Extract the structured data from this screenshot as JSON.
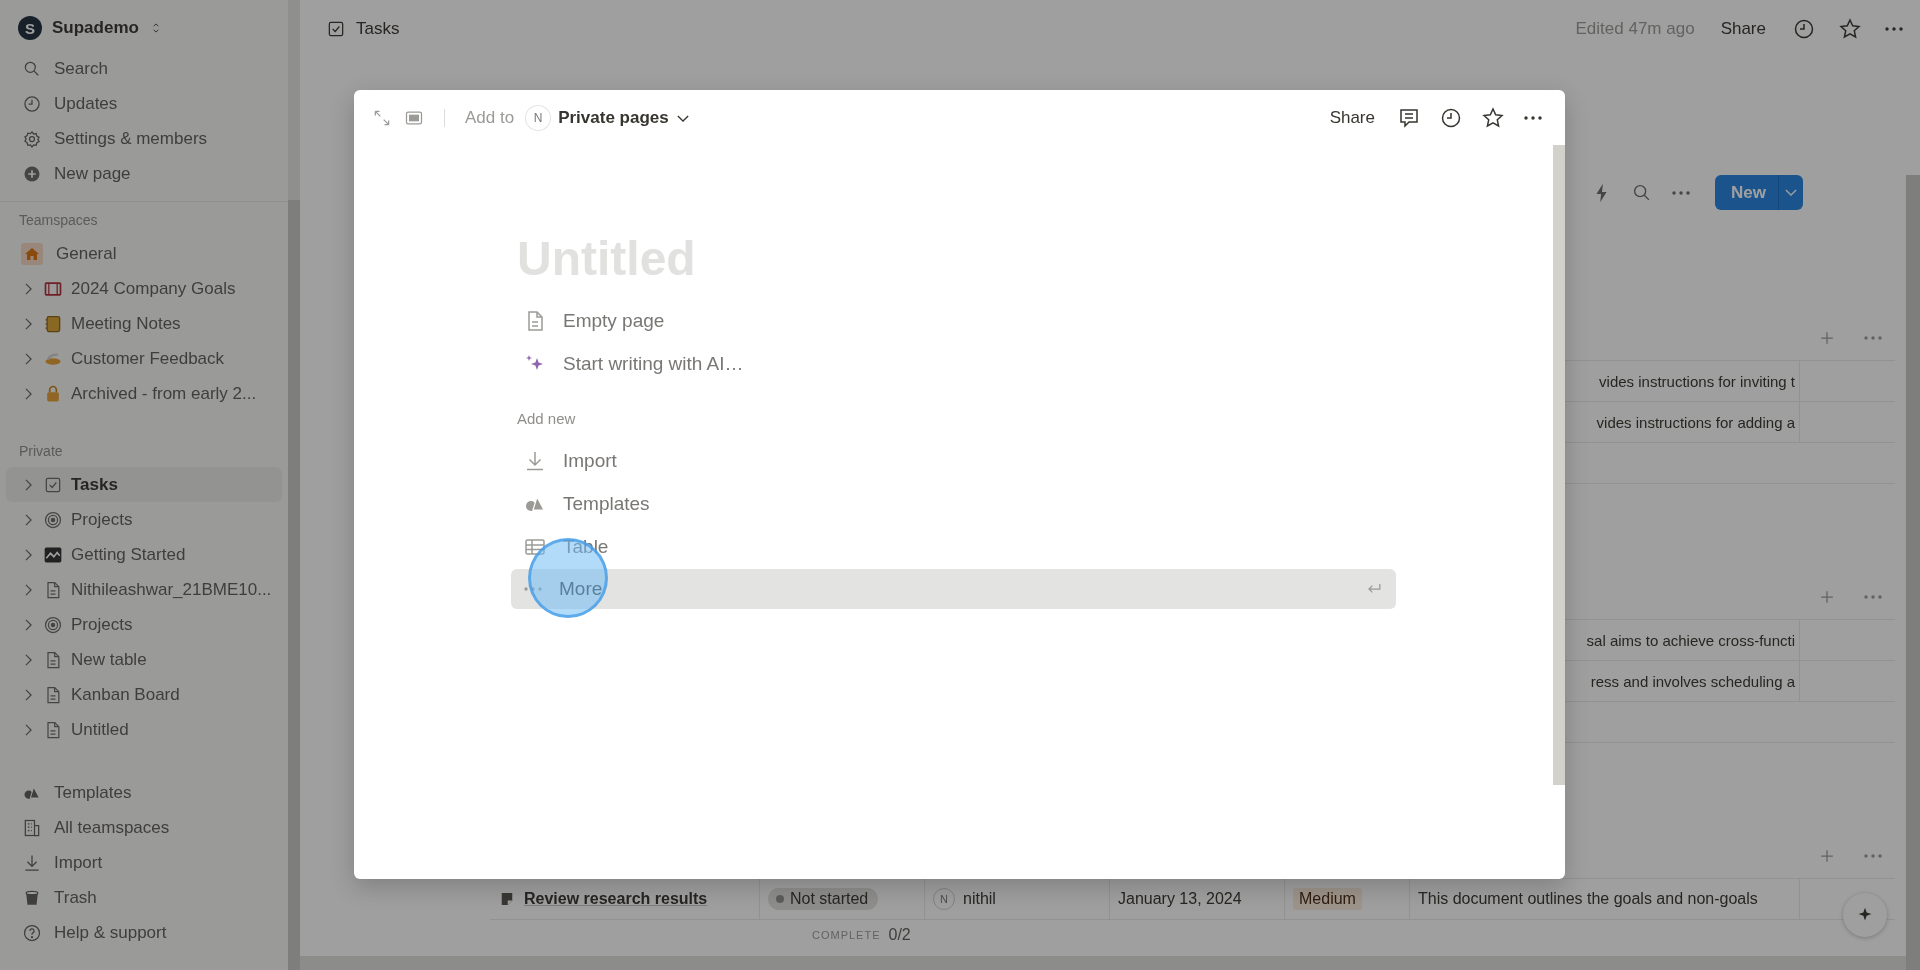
{
  "sidebar": {
    "workspace": {
      "avatar": "S",
      "name": "Supademo"
    },
    "actions": [
      {
        "kind": "search",
        "label": "Search"
      },
      {
        "kind": "clock",
        "label": "Updates"
      },
      {
        "kind": "gear",
        "label": "Settings & members"
      },
      {
        "kind": "plus",
        "label": "New page"
      }
    ],
    "sections": [
      {
        "title": "Teamspaces",
        "items": [
          {
            "kind": "home",
            "label": "General",
            "expandable": false,
            "selected": false
          },
          {
            "kind": "goals",
            "label": "2024 Company Goals",
            "expandable": true,
            "selected": false
          },
          {
            "kind": "notebook",
            "label": "Meeting Notes",
            "expandable": true,
            "selected": false
          },
          {
            "kind": "feedback",
            "label": "Customer Feedback",
            "expandable": true,
            "selected": false
          },
          {
            "kind": "lock",
            "label": "Archived - from early 2...",
            "expandable": true,
            "selected": false
          }
        ]
      },
      {
        "title": "Private",
        "items": [
          {
            "kind": "checkbox",
            "label": "Tasks",
            "expandable": true,
            "selected": true
          },
          {
            "kind": "target",
            "label": "Projects",
            "expandable": true,
            "selected": false
          },
          {
            "kind": "chart",
            "label": "Getting Started",
            "expandable": true,
            "selected": false
          },
          {
            "kind": "page",
            "label": "Nithileashwar_21BME10...",
            "expandable": true,
            "selected": false
          },
          {
            "kind": "target",
            "label": "Projects",
            "expandable": true,
            "selected": false
          },
          {
            "kind": "page",
            "label": "New table",
            "expandable": true,
            "selected": false
          },
          {
            "kind": "page",
            "label": "Kanban Board",
            "expandable": true,
            "selected": false
          },
          {
            "kind": "page",
            "label": "Untitled",
            "expandable": true,
            "selected": false
          }
        ]
      }
    ],
    "footer": [
      {
        "kind": "shapes",
        "label": "Templates"
      },
      {
        "kind": "building",
        "label": "All teamspaces"
      },
      {
        "kind": "download",
        "label": "Import"
      },
      {
        "kind": "trash",
        "label": "Trash"
      },
      {
        "kind": "help",
        "label": "Help & support"
      }
    ]
  },
  "topbar": {
    "breadcrumb": "Tasks",
    "edited": "Edited 47m ago",
    "share": "Share"
  },
  "toolbar": {
    "new_button": "New"
  },
  "groups": [
    {
      "rows": [
        {
          "kind": "partial",
          "description": "vides instructions for inviting t"
        },
        {
          "kind": "partial",
          "description": "vides instructions for adding a"
        }
      ]
    },
    {
      "rows": [
        {
          "kind": "partial",
          "description": "sal aims to achieve cross-functi"
        },
        {
          "kind": "partial",
          "description": "ress and involves scheduling a"
        }
      ]
    },
    {
      "rows": [
        {
          "kind": "full",
          "title": "Review research results",
          "status": "Not started",
          "assignee_initial": "N",
          "assignee": "nithil",
          "date": "January 13, 2024",
          "priority": "Medium",
          "description": "This document outlines the goals and non-goals"
        }
      ],
      "footer": {
        "label": "COMPLETE",
        "value": "0/2"
      }
    }
  ],
  "modal": {
    "header": {
      "add_to": "Add to",
      "avatar": "N",
      "location": "Private pages",
      "share": "Share"
    },
    "title_placeholder": "Untitled",
    "options": [
      {
        "kind": "page",
        "label": "Empty page",
        "selected": false
      },
      {
        "kind": "sparkle",
        "label": "Start writing with AI…",
        "selected": false
      }
    ],
    "add_new": {
      "title": "Add new",
      "items": [
        {
          "kind": "download",
          "label": "Import",
          "selected": false
        },
        {
          "kind": "shapes",
          "label": "Templates",
          "selected": false
        },
        {
          "kind": "table",
          "label": "Table",
          "selected": false
        },
        {
          "kind": "dots",
          "label": "More",
          "selected": true
        }
      ]
    }
  }
}
